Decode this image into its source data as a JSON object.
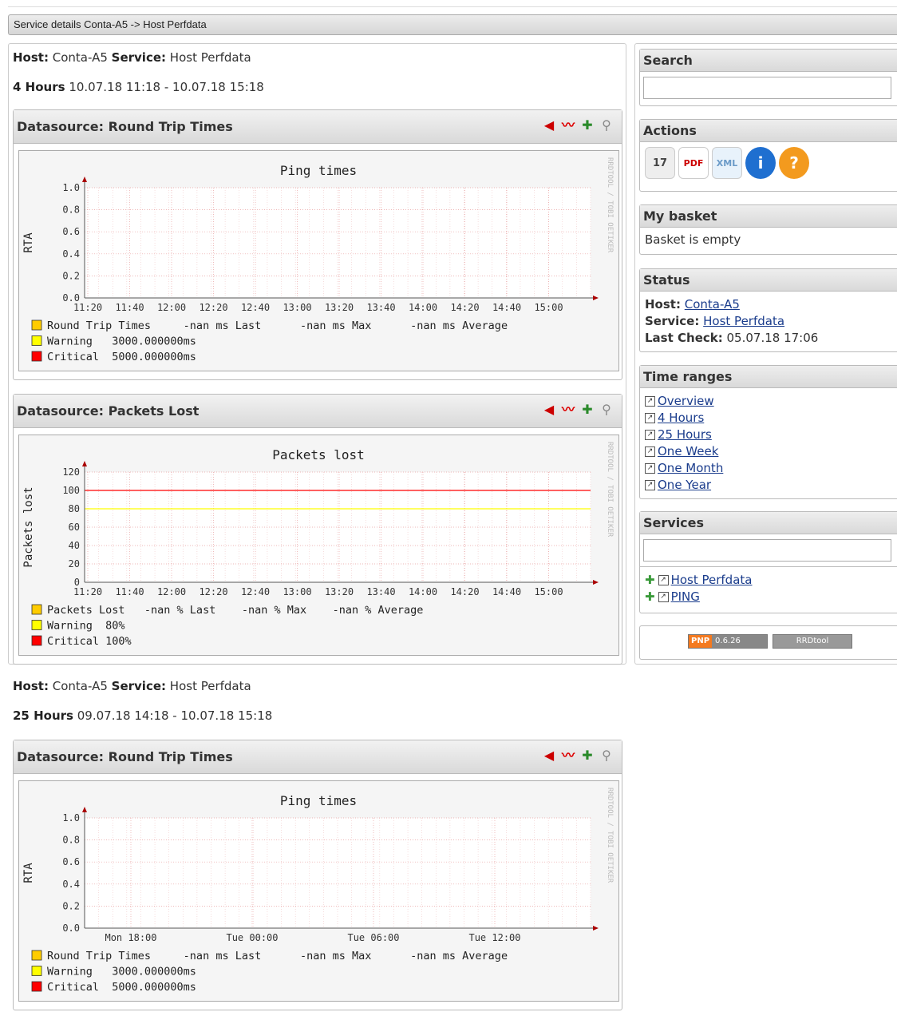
{
  "breadcrumb": "Service details Conta-A5 -> Host Perfdata",
  "sections": [
    {
      "host_label": "Host:",
      "host": "Conta-A5",
      "service_label": "Service:",
      "service": "Host Perfdata",
      "range_label": "4 Hours",
      "range": "10.07.18 11:18 - 10.07.18 15:18"
    },
    {
      "host_label": "Host:",
      "host": "Conta-A5",
      "service_label": "Service:",
      "service": "Host Perfdata",
      "range_label": "25 Hours",
      "range": "09.07.18 14:18 - 10.07.18 15:18"
    }
  ],
  "datasources": [
    {
      "title": "Datasource: Round Trip Times"
    },
    {
      "title": "Datasource: Packets Lost"
    },
    {
      "title": "Datasource: Round Trip Times"
    }
  ],
  "watermark": "RRDTOOL / TOBI OETIKER",
  "chart_data": [
    {
      "type": "line",
      "title": "Ping times",
      "ylabel": "RTA",
      "ylim": [
        0,
        1.0
      ],
      "yticks": [
        "1.0",
        "0.8",
        "0.6",
        "0.4",
        "0.2",
        "0.0"
      ],
      "xticks": [
        "11:20",
        "11:40",
        "12:00",
        "12:20",
        "12:40",
        "13:00",
        "13:20",
        "13:40",
        "14:00",
        "14:20",
        "14:40",
        "15:00"
      ],
      "series": [],
      "legend": [
        {
          "color": "#ffcc00",
          "text": "Round Trip Times     -nan ms Last      -nan ms Max      -nan ms Average"
        },
        {
          "color": "#ffff00",
          "text": "Warning   3000.000000ms"
        },
        {
          "color": "#ff0000",
          "text": "Critical  5000.000000ms"
        }
      ]
    },
    {
      "type": "line",
      "title": "Packets lost",
      "ylabel": "Packets lost",
      "ylim": [
        0,
        120
      ],
      "yticks": [
        "120",
        "100",
        "80",
        "60",
        "40",
        "20",
        "0"
      ],
      "xticks": [
        "11:20",
        "11:40",
        "12:00",
        "12:20",
        "12:40",
        "13:00",
        "13:20",
        "13:40",
        "14:00",
        "14:20",
        "14:40",
        "15:00"
      ],
      "hlines": [
        {
          "name": "Critical",
          "value": 100,
          "color": "#ff0000"
        },
        {
          "name": "Warning",
          "value": 80,
          "color": "#ffff00"
        }
      ],
      "legend": [
        {
          "color": "#ffcc00",
          "text": "Packets Lost   -nan % Last    -nan % Max    -nan % Average"
        },
        {
          "color": "#ffff00",
          "text": "Warning  80%"
        },
        {
          "color": "#ff0000",
          "text": "Critical 100%"
        }
      ]
    },
    {
      "type": "line",
      "title": "Ping times",
      "ylabel": "RTA",
      "ylim": [
        0,
        1.0
      ],
      "yticks": [
        "1.0",
        "0.8",
        "0.6",
        "0.4",
        "0.2",
        "0.0"
      ],
      "xticks": [
        "Mon 18:00",
        "Tue 00:00",
        "Tue 06:00",
        "Tue 12:00"
      ],
      "series": [],
      "legend": [
        {
          "color": "#ffcc00",
          "text": "Round Trip Times     -nan ms Last      -nan ms Max      -nan ms Average"
        },
        {
          "color": "#ffff00",
          "text": "Warning   3000.000000ms"
        },
        {
          "color": "#ff0000",
          "text": "Critical  5000.000000ms"
        }
      ]
    }
  ],
  "sidebar": {
    "search_title": "Search",
    "actions_title": "Actions",
    "basket_title": "My basket",
    "basket_text": "Basket is empty",
    "status_title": "Status",
    "status_host_label": "Host:",
    "status_host": "Conta-A5",
    "status_service_label": "Service:",
    "status_service": "Host Perfdata",
    "status_check_label": "Last Check:",
    "status_check": "05.07.18 17:06",
    "timeranges_title": "Time ranges",
    "timeranges": [
      "Overview",
      "4 Hours",
      "25 Hours",
      "One Week",
      "One Month",
      "One Year"
    ],
    "services_title": "Services",
    "services": [
      "Host Perfdata",
      "PING"
    ],
    "pnp_badge": "PNP",
    "pnp_version": "0.6.26",
    "rrd_badge": "RRDtool"
  }
}
